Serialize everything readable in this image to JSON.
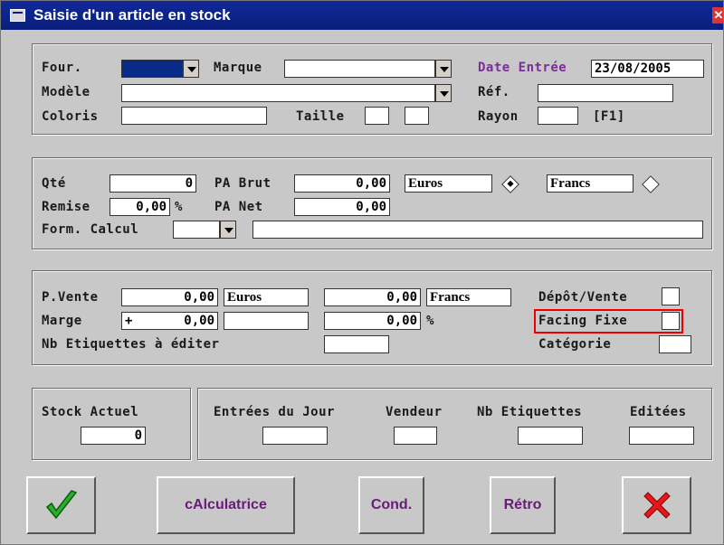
{
  "window": {
    "title": "Saisie d'un article en stock"
  },
  "section1": {
    "four_label": "Four.",
    "marque_label": "Marque",
    "date_entree_label": "Date Entrée",
    "date_entree_value": "23/08/2005",
    "modele_label": "Modèle",
    "ref_label": "Réf.",
    "coloris_label": "Coloris",
    "taille_label": "Taille",
    "rayon_label": "Rayon",
    "f1_hint": "[F1]"
  },
  "section2": {
    "qte_label": "Qté",
    "qte_value": "0",
    "pa_brut_label": "PA Brut",
    "pa_brut_value": "0,00",
    "currency_euros": "Euros",
    "currency_francs": "Francs",
    "remise_label": "Remise",
    "remise_value": "0,00",
    "remise_unit": "%",
    "pa_net_label": "PA Net",
    "pa_net_value": "0,00",
    "form_calcul_label": "Form. Calcul"
  },
  "section3": {
    "pvente_label": "P.Vente",
    "pvente_value": "0,00",
    "pvente_currency": "Euros",
    "pvente_francs_value": "0,00",
    "pvente_francs_currency": "Francs",
    "depot_vente_label": "Dépôt/Vente",
    "marge_label": "Marge",
    "marge_sign": "+",
    "marge_value": "0,00",
    "marge_pct_value": "0,00",
    "marge_pct_unit": "%",
    "facing_fixe_label": "Facing Fixe",
    "nb_etiquettes_label": "Nb Etiquettes à éditer",
    "categorie_label": "Catégorie"
  },
  "stock": {
    "stock_actuel_label": "Stock Actuel",
    "stock_actuel_value": "0",
    "entrees_jour_label": "Entrées du Jour",
    "vendeur_label": "Vendeur",
    "nb_etiquettes_label": "Nb Etiquettes",
    "editees_label": "Editées"
  },
  "buttons": {
    "calculatrice": "cAlculatrice",
    "cond": "Cond.",
    "retro": "Rétro"
  }
}
